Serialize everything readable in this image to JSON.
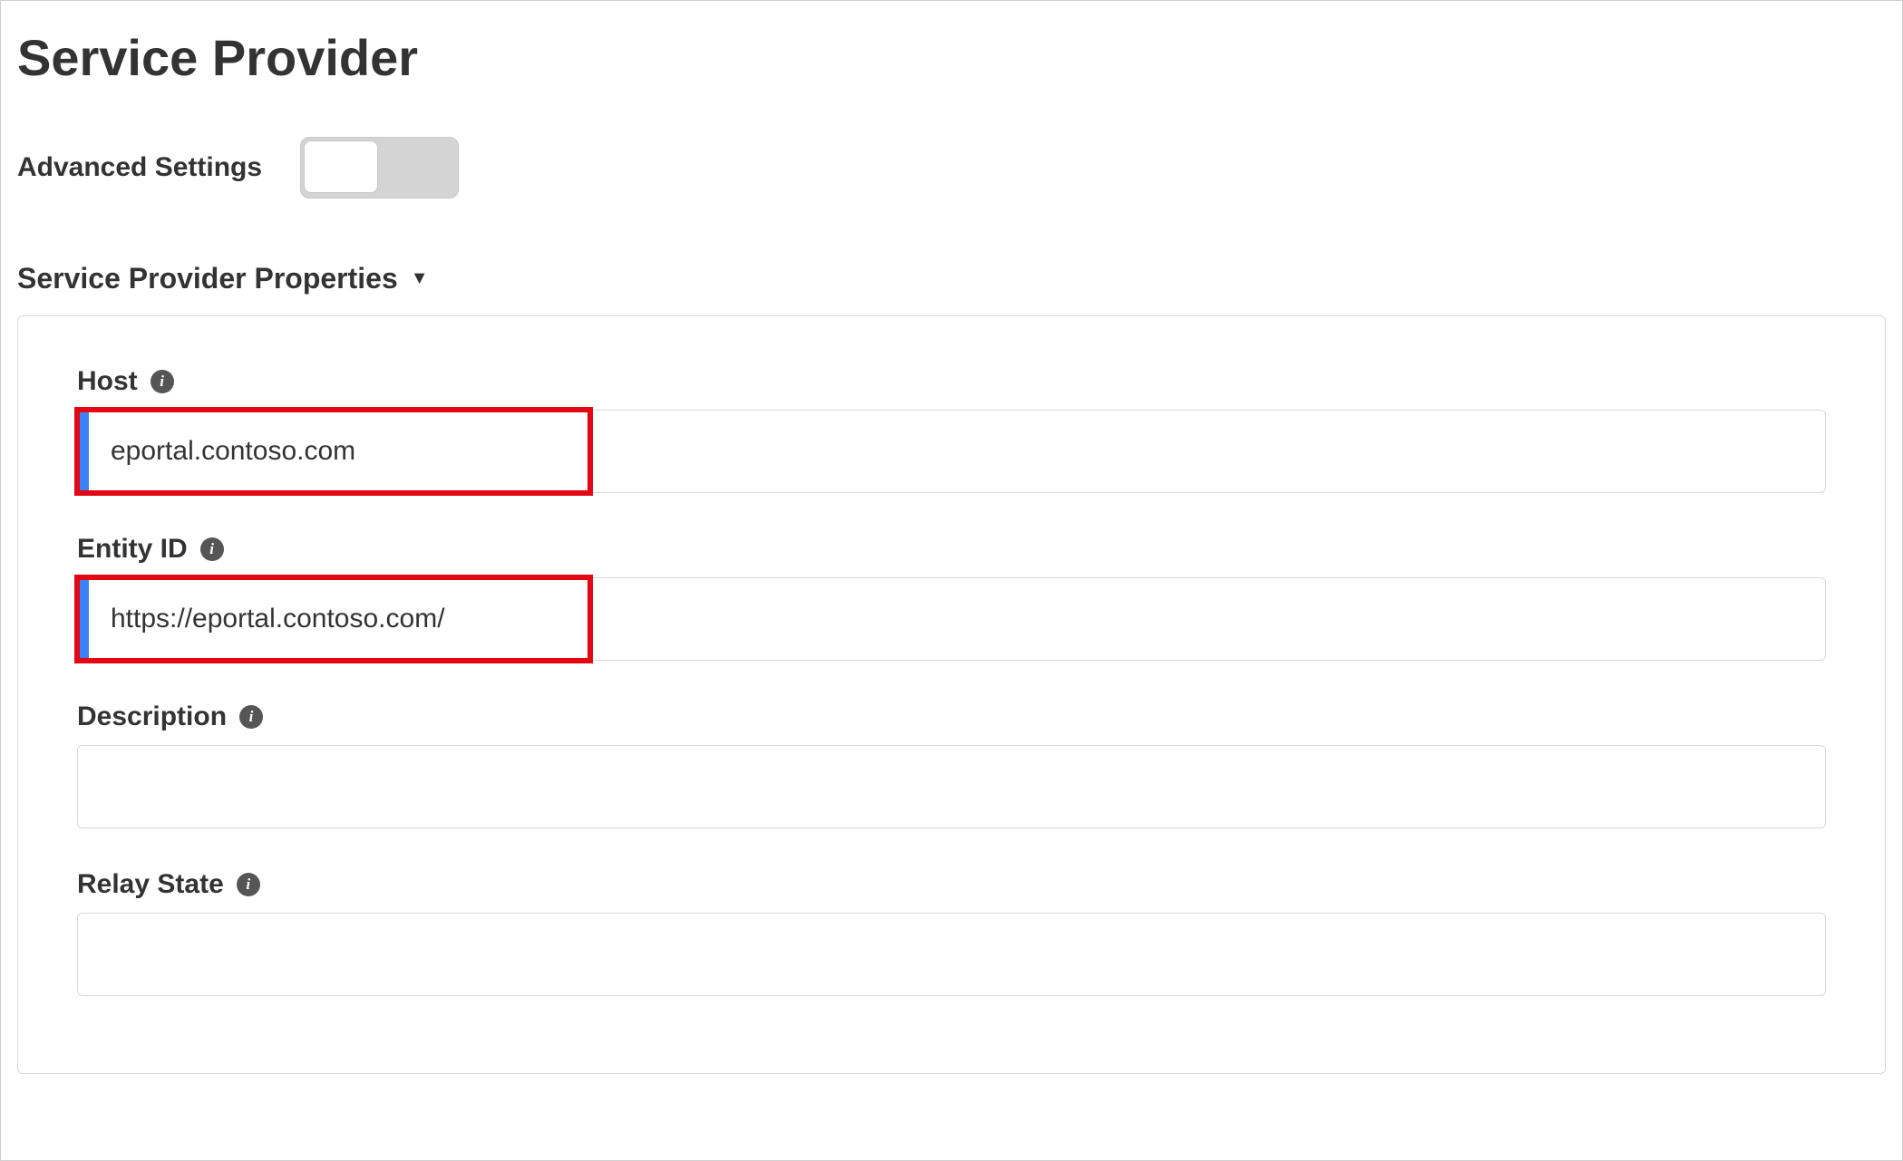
{
  "page": {
    "title": "Service Provider"
  },
  "advanced": {
    "label": "Advanced Settings",
    "enabled": false
  },
  "section": {
    "title": "Service Provider Properties"
  },
  "fields": {
    "host": {
      "label": "Host",
      "value": "eportal.contoso.com"
    },
    "entityId": {
      "label": "Entity ID",
      "value": "https://eportal.contoso.com/"
    },
    "description": {
      "label": "Description",
      "value": ""
    },
    "relayState": {
      "label": "Relay State",
      "value": ""
    }
  }
}
